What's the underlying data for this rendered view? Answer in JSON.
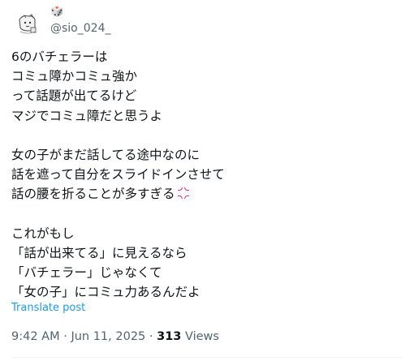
{
  "user": {
    "display_name": "🎲",
    "handle": "@sio_024_"
  },
  "tweet": {
    "lines": [
      "6のバチェラーは",
      "コミュ障かコミュ強か",
      "って話題が出てるけど",
      "マジでコミュ障だと思うよ",
      "",
      "女の子がまだ話してる途中なのに",
      "話を遮って自分をスライドインさせて",
      "話の腰を折ることが多すぎる",
      "",
      "これがもし",
      "「話が出来てる」に見えるなら",
      "「バチェラー」じゃなくて",
      "「女の子」にコミュ力あるんだよ"
    ],
    "emoji_after_line_8": "anger-symbol-icon"
  },
  "translate_label": "Translate post",
  "meta": {
    "time": "9:42 AM",
    "separator_1": " · ",
    "date": "Jun 11, 2025",
    "separator_2": " · ",
    "views_count": "313",
    "views_label": " Views"
  },
  "colors": {
    "text": "#0f1419",
    "secondary": "#536471",
    "link": "#1d9bf0",
    "anger_emoji": "#e0245e"
  }
}
